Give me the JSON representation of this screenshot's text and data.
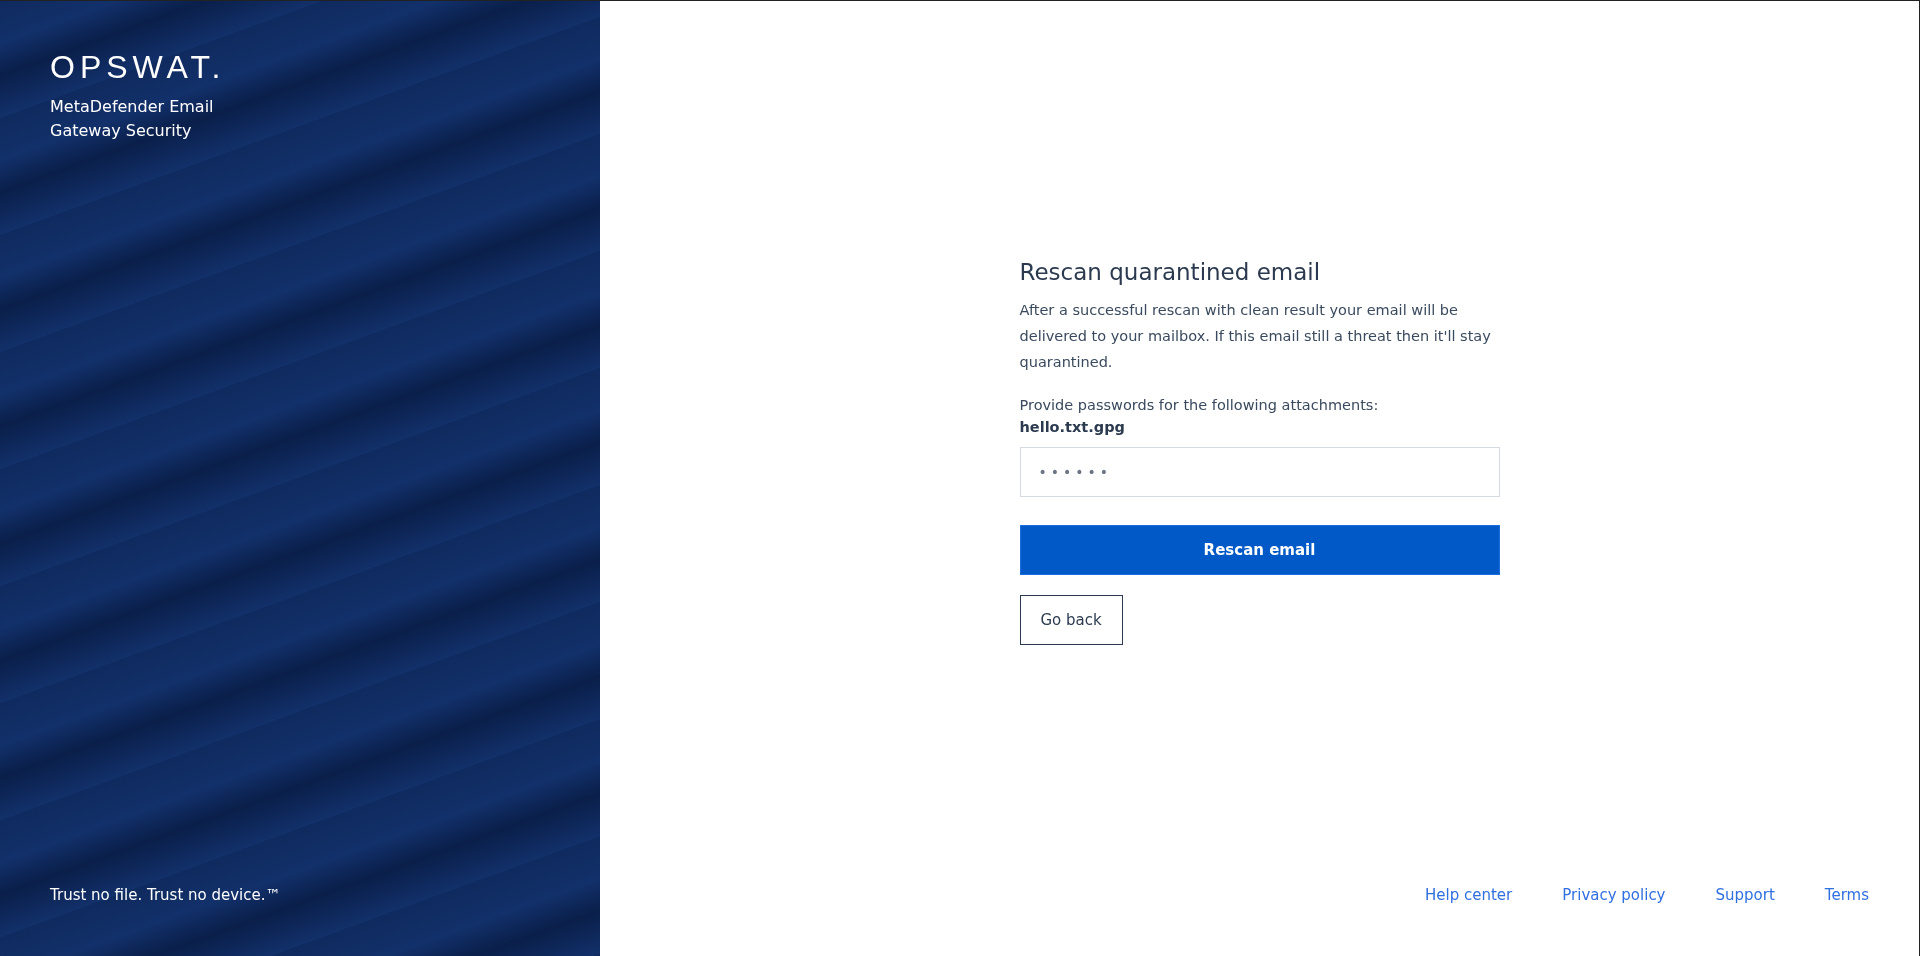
{
  "brand": {
    "logo": "OPSWAT.",
    "product": "MetaDefender Email Gateway Security",
    "tagline": "Trust no file. Trust no device.™"
  },
  "form": {
    "title": "Rescan quarantined email",
    "description": "After a successful rescan with clean result your email will be delivered to your mailbox. If this email still a threat then it'll stay quarantined.",
    "prompt": "Provide passwords for the following attachments:",
    "attachments": [
      {
        "name": "hello.txt.gpg",
        "password": "••••••"
      }
    ],
    "primary_button": "Rescan email",
    "secondary_button": "Go back"
  },
  "footer_links": [
    "Help center",
    "Privacy policy",
    "Support",
    "Terms"
  ]
}
